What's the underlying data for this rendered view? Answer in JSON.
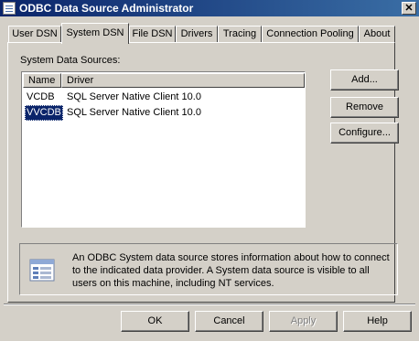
{
  "window": {
    "title": "ODBC Data Source Administrator",
    "close_glyph": "✕",
    "icon": "odbc-app-icon"
  },
  "tabs": [
    {
      "label": "User DSN",
      "active": false
    },
    {
      "label": "System DSN",
      "active": true
    },
    {
      "label": "File DSN",
      "active": false
    },
    {
      "label": "Drivers",
      "active": false
    },
    {
      "label": "Tracing",
      "active": false
    },
    {
      "label": "Connection Pooling",
      "active": false
    },
    {
      "label": "About",
      "active": false
    }
  ],
  "system_dsn": {
    "list_label": "System Data Sources:",
    "columns": [
      "Name",
      "Driver"
    ],
    "rows": [
      {
        "name": "VCDB",
        "driver": "SQL Server Native Client 10.0",
        "selected": false
      },
      {
        "name": "VVCDB",
        "driver": "SQL Server Native Client 10.0",
        "selected": true
      }
    ],
    "buttons": {
      "add": "Add...",
      "remove": "Remove",
      "configure": "Configure..."
    },
    "info_text": "An ODBC System data source stores information about how to connect to the indicated data provider.   A System data source is visible to all users on this machine, including NT services.",
    "info_icon": "database-icon"
  },
  "footer": {
    "ok": "OK",
    "cancel": "Cancel",
    "apply": "Apply",
    "help": "Help"
  },
  "colors": {
    "titlebar_start": "#0a246a",
    "titlebar_end": "#3a6ea5",
    "face": "#d4d0c8",
    "selection": "#0a246a"
  }
}
